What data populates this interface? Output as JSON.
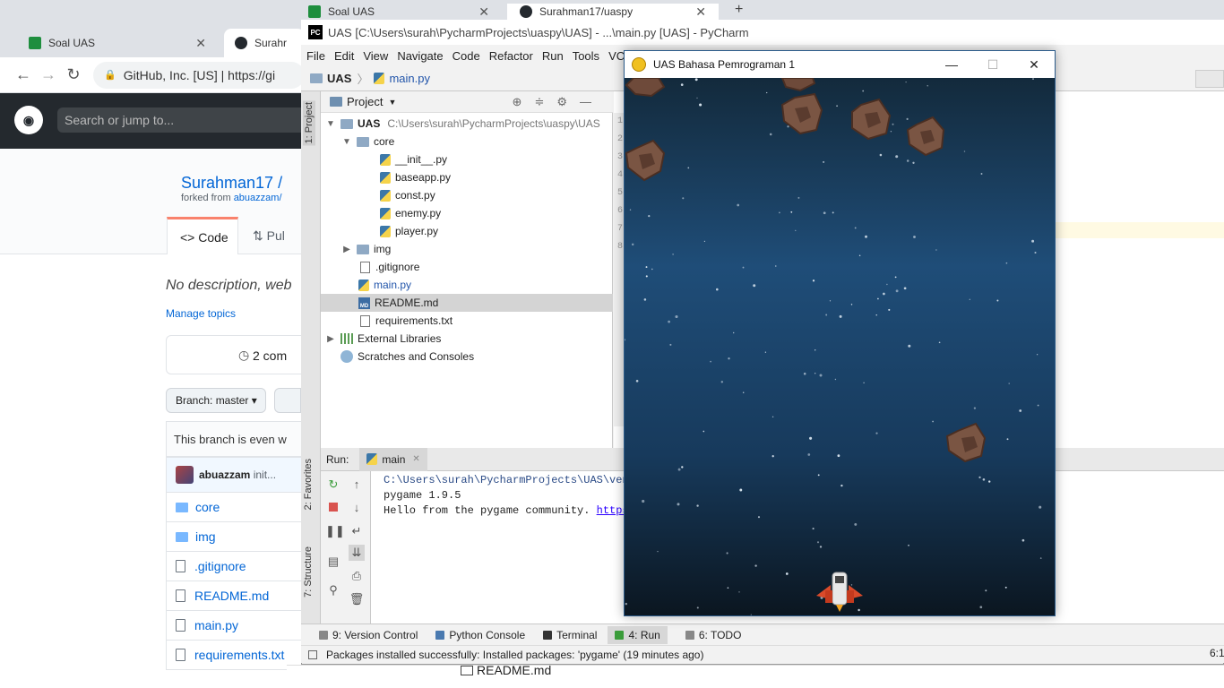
{
  "chrome_back": {
    "tabs": [
      {
        "label": "Soal UAS"
      },
      {
        "label": "Surahr"
      }
    ],
    "omnibox": "GitHub, Inc. [US]  |  https://gi",
    "search_placeholder": "Search or jump to...",
    "repo_owner": "Surahman17 /",
    "forked_prefix": "forked from ",
    "forked_from": "abuazzam/",
    "code_tab": "Code",
    "pull_tab": "Pul",
    "description": "No description, web",
    "manage_topics": "Manage topics",
    "commits": "2 com",
    "branch_button": "Branch: master ▾",
    "branch_note": "This branch is even w",
    "commit_author": "abuazzam",
    "commit_msg": "init...",
    "files": [
      {
        "name": "core",
        "type": "folder"
      },
      {
        "name": "img",
        "type": "folder"
      },
      {
        "name": ".gitignore",
        "type": "file"
      },
      {
        "name": "README.md",
        "type": "file"
      },
      {
        "name": "main.py",
        "type": "file"
      },
      {
        "name": "requirements.txt",
        "type": "file"
      }
    ]
  },
  "chrome_front": {
    "tabs": [
      {
        "label": "Soal UAS"
      },
      {
        "label": "Surahman17/uaspy"
      }
    ]
  },
  "pycharm": {
    "title": "UAS [C:\\Users\\surah\\PycharmProjects\\uaspy\\UAS] - ...\\main.py [UAS] - PyCharm",
    "menu": [
      "File",
      "Edit",
      "View",
      "Navigate",
      "Code",
      "Refactor",
      "Run",
      "Tools",
      "VCS"
    ],
    "breadcrumb": {
      "project": "UAS",
      "file": "main.py"
    },
    "left_strip": {
      "project": "1: Project",
      "favorites": "2: Favorites",
      "structure": "7: Structure"
    },
    "project_header": "Project",
    "tree": {
      "root": "UAS",
      "root_path": "C:\\Users\\surah\\PycharmProjects\\uaspy\\UAS",
      "core": "core",
      "core_files": [
        "__init__.py",
        "baseapp.py",
        "const.py",
        "enemy.py",
        "player.py"
      ],
      "img": "img",
      "gitignore": ".gitignore",
      "main": "main.py",
      "readme": "README.md",
      "requirements": "requirements.txt",
      "external": "External Libraries",
      "scratches": "Scratches and Consoles"
    },
    "line_numbers": [
      "1",
      "2",
      "3",
      "4",
      "5",
      "6",
      "7",
      "8"
    ],
    "run_label": "Run:",
    "run_tab": "main",
    "console": {
      "line1": "C:\\Users\\surah\\PycharmProjects\\UAS\\venv",
      "line2": "pygame 1.9.5",
      "line3_text": "Hello from the pygame community. ",
      "line3_link": "https"
    },
    "bottom_tabs": [
      {
        "label": "9: Version Control"
      },
      {
        "label": "Python Console"
      },
      {
        "label": "Terminal"
      },
      {
        "label": "4: Run"
      },
      {
        "label": "6: TODO"
      }
    ],
    "status": "Packages installed successfully: Installed packages: 'pygame' (19 minutes ago)",
    "status_right": "6:1",
    "readme_peek": "README.md"
  },
  "pygame": {
    "title": "UAS Bahasa Pemrograman 1",
    "minimize": "—",
    "maximize": "☐",
    "close": "✕",
    "colors": {
      "sky_top": "#1f4d78",
      "sky_bottom": "#0b1620",
      "rock": "#7a5543",
      "ship": "#d94a2a"
    }
  }
}
